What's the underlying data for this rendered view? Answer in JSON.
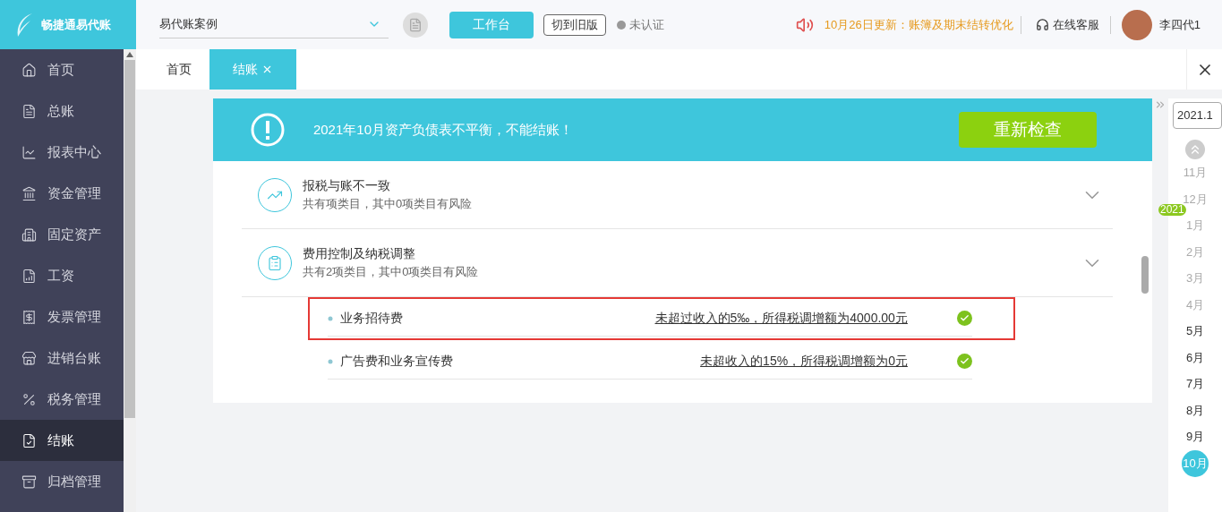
{
  "brand": {
    "name": "畅捷通易代账"
  },
  "header": {
    "company": "易代账案例",
    "workbench": "工作台",
    "switch_old": "切到旧版",
    "verify": "未认证",
    "notice": "10月26日更新：账簿及期末结转优化",
    "service": "在线客服",
    "user": "李四代1"
  },
  "sidebar": {
    "items": [
      {
        "label": "首页",
        "selected": false
      },
      {
        "label": "总账",
        "selected": false
      },
      {
        "label": "报表中心",
        "selected": false
      },
      {
        "label": "资金管理",
        "selected": false
      },
      {
        "label": "固定资产",
        "selected": false
      },
      {
        "label": "工资",
        "selected": false
      },
      {
        "label": "发票管理",
        "selected": false
      },
      {
        "label": "进销台账",
        "selected": false
      },
      {
        "label": "税务管理",
        "selected": false
      },
      {
        "label": "结账",
        "selected": true
      },
      {
        "label": "归档管理",
        "selected": false
      }
    ]
  },
  "tabs": [
    {
      "label": "首页",
      "selected": false
    },
    {
      "label": "结账",
      "selected": true
    }
  ],
  "alert": {
    "message": "2021年10月资产负债表不平衡，不能结账！",
    "button": "重新检查"
  },
  "sections": [
    {
      "title": "报税与账不一致",
      "subtitle": "共有项类目，其中0项类目有风险"
    },
    {
      "title": "费用控制及纳税调整",
      "subtitle": "共有2项类目，其中0项类目有风险",
      "items": [
        {
          "name": "业务招待费",
          "result": "未超过收入的5‰，所得税调增额为4000.00元",
          "ok": true,
          "highlighted": true
        },
        {
          "name": "广告费和业务宣传费",
          "result": "未超收入的15%，所得税调增额为0元",
          "ok": true,
          "highlighted": false
        }
      ]
    }
  ],
  "period": {
    "value": "2021.1",
    "year": "2021",
    "months": [
      {
        "label": "11月",
        "disabled": true,
        "selected": false
      },
      {
        "label": "12月",
        "disabled": true,
        "selected": false
      },
      {
        "label": "1月",
        "disabled": true,
        "selected": false
      },
      {
        "label": "2月",
        "disabled": true,
        "selected": false
      },
      {
        "label": "3月",
        "disabled": true,
        "selected": false
      },
      {
        "label": "4月",
        "disabled": true,
        "selected": false
      },
      {
        "label": "5月",
        "disabled": false,
        "selected": false
      },
      {
        "label": "6月",
        "disabled": false,
        "selected": false
      },
      {
        "label": "7月",
        "disabled": false,
        "selected": false
      },
      {
        "label": "8月",
        "disabled": false,
        "selected": false
      },
      {
        "label": "9月",
        "disabled": false,
        "selected": false
      },
      {
        "label": "10月",
        "disabled": false,
        "selected": true
      }
    ]
  }
}
